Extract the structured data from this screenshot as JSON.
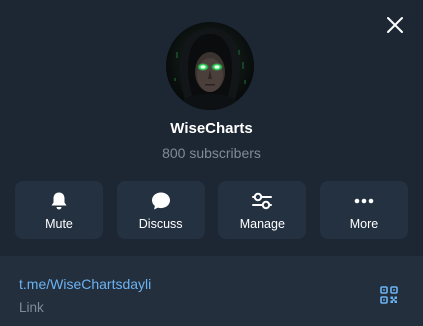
{
  "profile": {
    "channel_name": "WiseCharts",
    "subscribers": "800 subscribers",
    "avatar_icon": "hooded-figure-avatar"
  },
  "actions": [
    {
      "label": "Mute",
      "icon": "bell-icon"
    },
    {
      "label": "Discuss",
      "icon": "chat-bubble-icon"
    },
    {
      "label": "Manage",
      "icon": "sliders-icon"
    },
    {
      "label": "More",
      "icon": "more-dots-icon"
    }
  ],
  "info": {
    "link": "t.me/WiseChartsdayli",
    "link_caption": "Link",
    "qr_icon": "qr-code-icon"
  },
  "colors": {
    "background": "#1d2733",
    "info_background": "#242f3d",
    "button_background": "#243140",
    "link": "#6ab3f3",
    "muted_text": "#7f8b97",
    "avatar_eyes": "#39ff6a"
  }
}
